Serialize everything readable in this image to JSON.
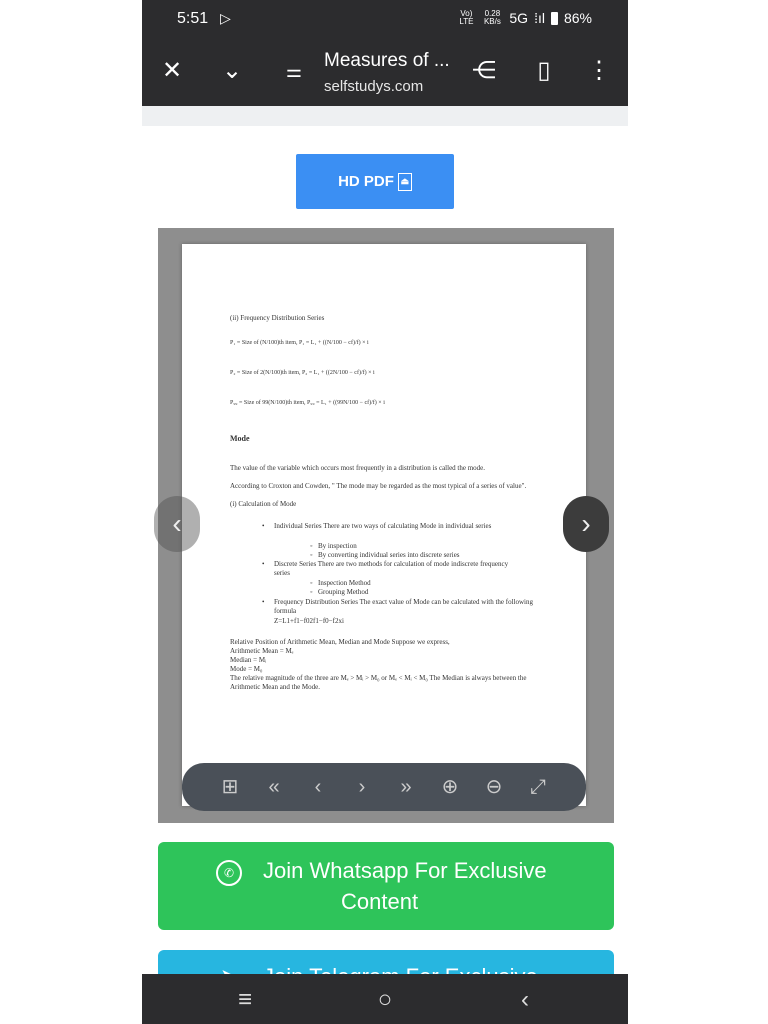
{
  "status": {
    "time": "5:51",
    "volte": "Vo) LTE",
    "speed": "0.28 KB/s",
    "network": "5G",
    "battery": "86%"
  },
  "toolbar": {
    "title": "Measures of ...",
    "url": "selfstudys.com"
  },
  "content": {
    "hd_pdf_label": "HD PDF"
  },
  "pdf_page": {
    "section_title": "(ii) Frequency Distribution Series",
    "formula1": "P₁ = Size of (N/100)th item, P₁ = L₁ + ((N/100 − cf)/f) × i",
    "formula2": "P₂ = Size of 2(N/100)th item, P₂ = L₁ + ((2N/100 − cf)/f) × i",
    "formula3": "P₉₉ = Size of 99(N/100)th item, P₉₉ = L₁ + ((99N/100 − cf)/f) × i",
    "mode_heading": "Mode",
    "p1": "The value of the variable which occurs most frequently in a distribution is called the mode.",
    "p2": "According to Croxton and Cowden, \" The mode may be regarded as the most typical of a series of value\".",
    "p3": "(i) Calculation of Mode",
    "b1": "Individual Series There are two ways of calculating Mode in individual series",
    "b1a": "By inspection",
    "b1b": "By converting individual series into discrete series",
    "b2": "Discrete Series There are two methods for calculation of mode indiscrete frequency series",
    "b2a": "Inspection Method",
    "b2b": "Grouping Method",
    "b3": "Frequency Distribution Series The exact value of Mode can be calculated with the following formula",
    "b3f": "Z=L1+f1−f02f1−f0−f2xi",
    "r1": "Relative Position of Arithmetic Mean, Median and Mode Suppose we express,",
    "r2": "Arithmetic Mean = Mₑ",
    "r3": "Median = Mᵢ",
    "r4": "Mode = M₀",
    "r5": "The relative magnitude of the three are Mₑ > Mᵢ > M₀ or Mₑ < Mᵢ < M₀ The Median is always between the Arithmetic Mean and the Mode."
  },
  "whatsapp": {
    "line1": "Join Whatsapp For Exclusive",
    "line2": "Content"
  },
  "telegram": {
    "line1": "Join Telegram For Exclusive"
  },
  "colors": {
    "hd_pdf": "#3b8ff3",
    "whatsapp": "#2ec45a",
    "telegram": "#27b6e0",
    "dark_bar": "#2c2c2e"
  }
}
